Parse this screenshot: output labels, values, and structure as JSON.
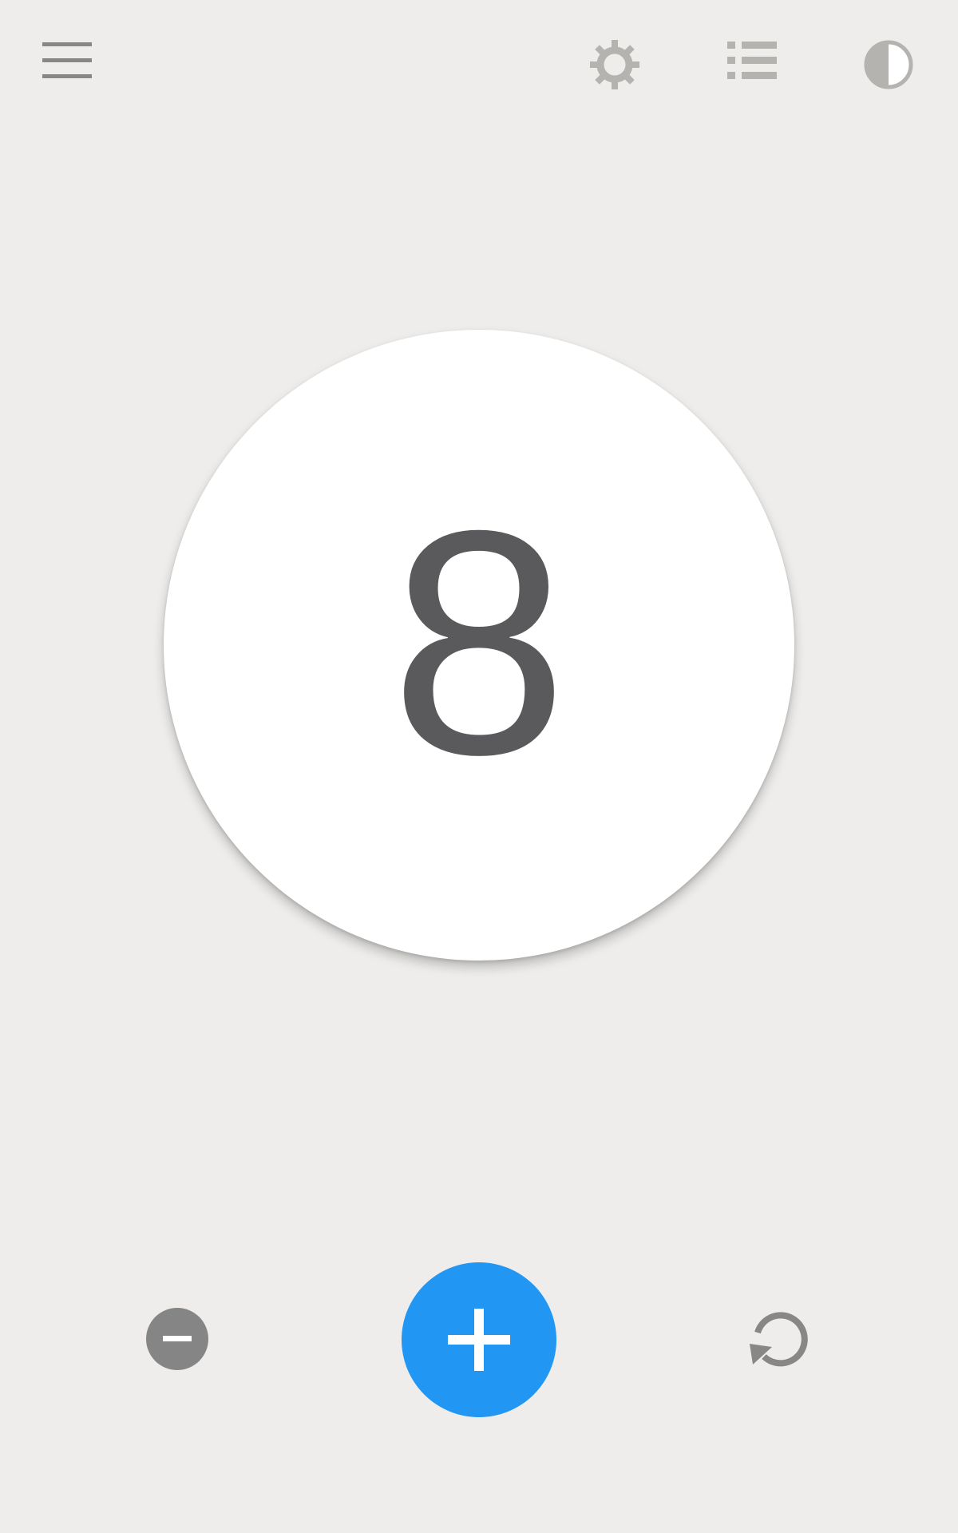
{
  "toolbar": {
    "menu_icon": "hamburger-menu-icon",
    "settings_icon": "gear-icon",
    "list_icon": "list-icon",
    "theme_icon": "contrast-icon",
    "icon_color": "#888785",
    "icon_color_light": "#b4b3b0"
  },
  "counter": {
    "value": "8",
    "text_color": "#5a595c",
    "background": "#ffffff"
  },
  "controls": {
    "decrement_icon": "minus-icon",
    "increment_icon": "plus-icon",
    "reset_icon": "reset-icon",
    "accent_color": "#2196f3",
    "decrement_color": "#858585"
  },
  "app": {
    "background": "#eeedeb"
  }
}
